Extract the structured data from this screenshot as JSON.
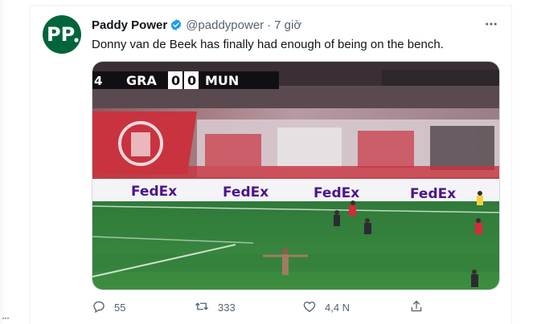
{
  "tweet": {
    "avatar_text": "PP",
    "display_name": "Paddy Power",
    "handle": "@paddypower",
    "separator": "·",
    "time": "7 giờ",
    "text": "Donny van de Beek has finally had enough of being on the bench.",
    "icons": [
      "verified-badge-icon",
      "more-icon",
      "reply-icon",
      "retweet-icon",
      "like-icon",
      "share-icon"
    ]
  },
  "scoreboard": {
    "left_fragment": "4",
    "home": "GRA",
    "home_score": "0",
    "away_score": "0",
    "away": "MUN"
  },
  "stadium": {
    "ad_text": "FedEx"
  },
  "actions": {
    "replies": "55",
    "retweets": "333",
    "likes": "4,4 N"
  },
  "colors": {
    "accent_blue": "#1d9bf0",
    "secondary_text": "#536471",
    "brand_green": "#00653b"
  }
}
